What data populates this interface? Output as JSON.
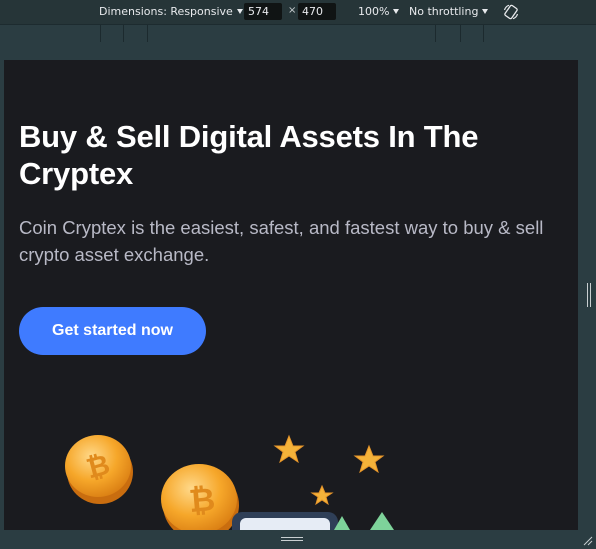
{
  "devtools": {
    "dimensions_label": "Dimensions: Responsive",
    "width_value": "574",
    "height_value": "470",
    "separator": "×",
    "zoom_label": "100%",
    "throttling_label": "No throttling",
    "rotate_icon": "rotate-icon"
  },
  "hero": {
    "title": "Buy & Sell Digital Assets In The Cryptex",
    "description": "Coin Cryptex is the easiest, safest, and fastest way to buy & sell crypto asset exchange.",
    "cta_label": "Get started now"
  },
  "colors": {
    "page_bg": "#1a1b1f",
    "accent": "#3f7bff",
    "coin": "#f6a72a",
    "star": "#f4b33a"
  }
}
